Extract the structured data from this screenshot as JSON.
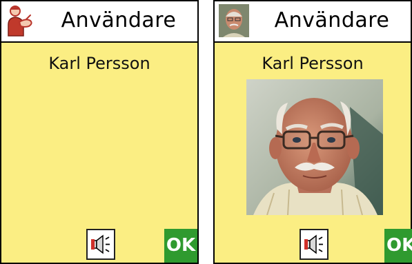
{
  "panels": [
    {
      "header": {
        "title": "Användare",
        "icon": "sign-language-person-icon"
      },
      "user": {
        "name": "Karl Persson"
      },
      "footer": {
        "speaker_icon": "speaker-icon",
        "ok_label": "OK"
      }
    },
    {
      "header": {
        "title": "Användare",
        "icon": "user-photo-thumbnail"
      },
      "user": {
        "name": "Karl Persson",
        "photo": "user-portrait-photo"
      },
      "footer": {
        "speaker_icon": "speaker-icon",
        "ok_label": "OK"
      }
    }
  ],
  "colors": {
    "panel_background": "#fbee83",
    "header_background": "#ffffff",
    "ok_button": "#2f9a2f",
    "icon_accent": "#c0392b"
  }
}
